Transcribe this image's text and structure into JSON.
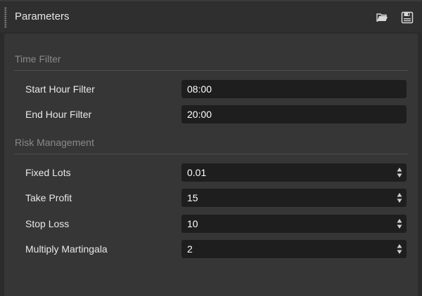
{
  "window": {
    "title": "Parameters",
    "icons": [
      "folder-open-icon",
      "save-icon"
    ]
  },
  "sections": [
    {
      "title": "Time Filter",
      "rows": [
        {
          "label": "Start Hour Filter",
          "value": "08:00",
          "type": "text"
        },
        {
          "label": "End Hour Filter",
          "value": "20:00",
          "type": "text"
        }
      ]
    },
    {
      "title": "Risk Management",
      "rows": [
        {
          "label": "Fixed Lots",
          "value": "0.01",
          "type": "number"
        },
        {
          "label": "Take Profit",
          "value": "15",
          "type": "number"
        },
        {
          "label": "Stop Loss",
          "value": "10",
          "type": "number"
        },
        {
          "label": "Multiply Martingala",
          "value": "2",
          "type": "number"
        }
      ]
    }
  ],
  "colors": {
    "background": "#2b2b2b",
    "panel": "#363636",
    "field": "#1e1e1e",
    "section_title": "#8a8a8a",
    "text": "#e8e8e8"
  }
}
